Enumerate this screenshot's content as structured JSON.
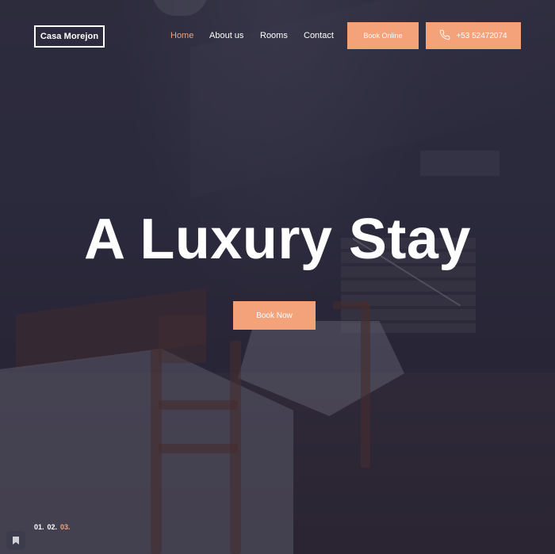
{
  "header": {
    "logo": "Casa Morejon",
    "nav": [
      {
        "label": "Home",
        "active": true
      },
      {
        "label": "About us",
        "active": false
      },
      {
        "label": "Rooms",
        "active": false
      },
      {
        "label": "Contact",
        "active": false
      }
    ],
    "book_online_label": "Book Online",
    "phone_label": "+53 52472074",
    "phone_icon": "phone-icon"
  },
  "hero": {
    "title": "A Luxury Stay",
    "cta_label": "Book Now"
  },
  "slider": {
    "items": [
      "01.",
      "02.",
      "03."
    ],
    "current": "03."
  },
  "colors": {
    "accent": "#f4a27a",
    "text": "#ffffff"
  }
}
